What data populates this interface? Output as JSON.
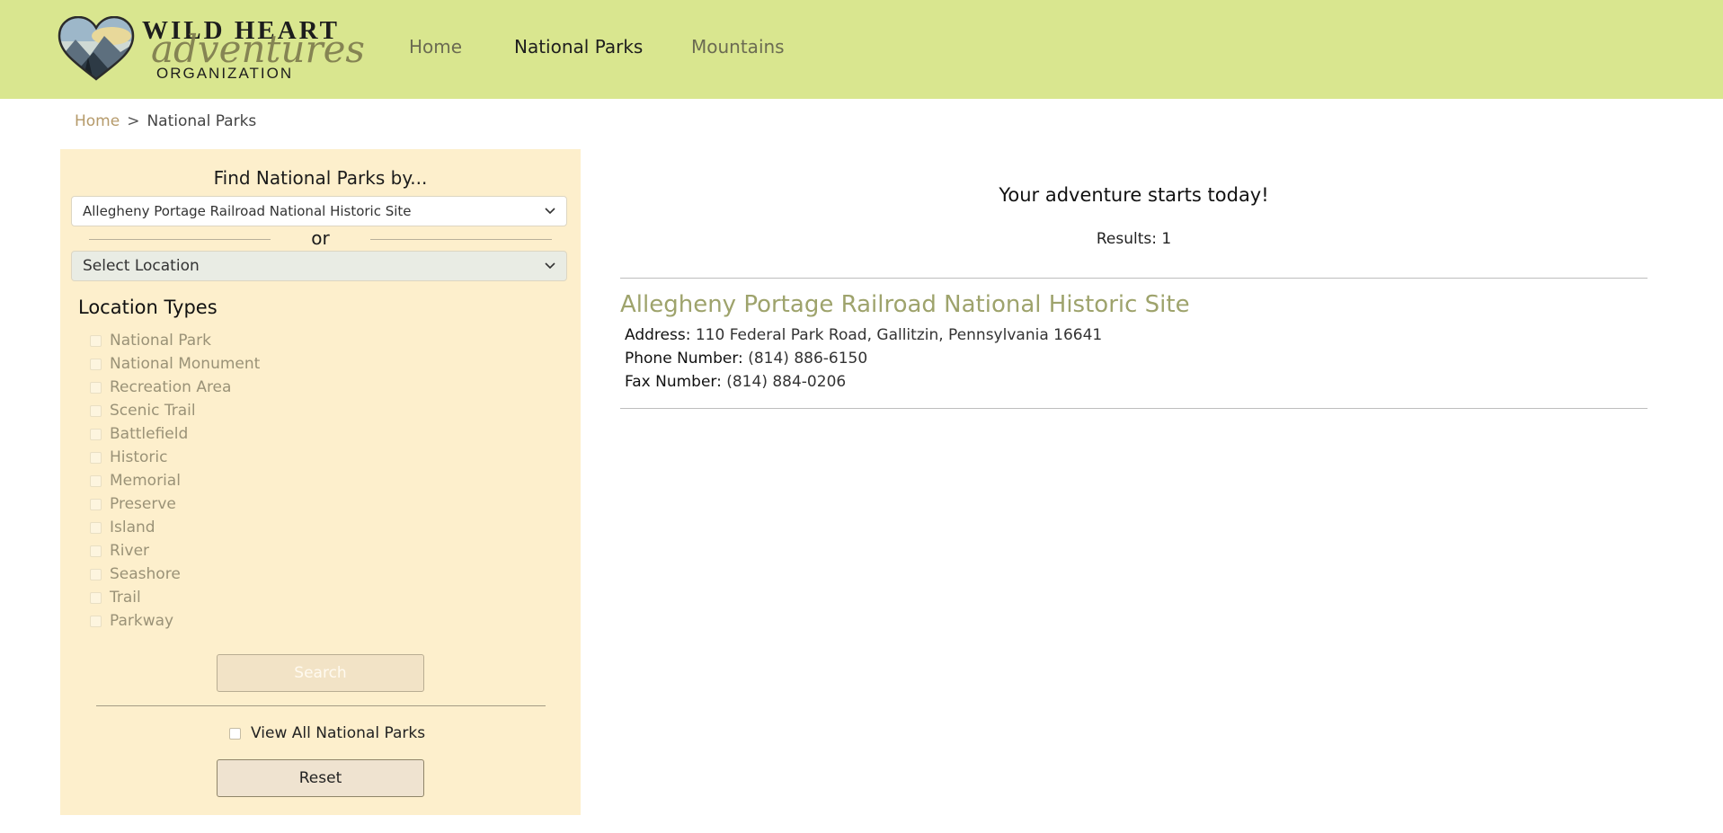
{
  "logo": {
    "line1": "WILD HEART",
    "line2": "adventures",
    "line3": "ORGANIZATION"
  },
  "nav": {
    "items": [
      {
        "label": "Home",
        "color": "#6b6b52"
      },
      {
        "label": "National Parks",
        "color": "#1e1e1e"
      },
      {
        "label": "Mountains",
        "color": "#6b6b52"
      }
    ]
  },
  "breadcrumb": {
    "home": "Home",
    "separator": ">",
    "current": "National Parks"
  },
  "sidebar": {
    "find_title": "Find National Parks by...",
    "park_select_value": "Allegheny Portage Railroad National Historic Site",
    "or_text": "or",
    "location_select_value": "Select Location",
    "location_types_title": "Location Types",
    "location_types": [
      "National Park",
      "National Monument",
      "Recreation Area",
      "Scenic Trail",
      "Battlefield",
      "Historic",
      "Memorial",
      "Preserve",
      "Island",
      "River",
      "Seashore",
      "Trail",
      "Parkway"
    ],
    "search_label": "Search",
    "view_all_label": "View All National Parks",
    "reset_label": "Reset"
  },
  "main": {
    "heading": "Your adventure starts today!",
    "results_label": "Results: 1",
    "result": {
      "name": "Allegheny Portage Railroad National Historic Site",
      "address_label": "Address:",
      "address": "110 Federal Park Road, Gallitzin, Pennsylvania 16641",
      "phone_label": "Phone Number:",
      "phone": "(814) 886-6150",
      "fax_label": "Fax Number:",
      "fax": "(814) 884-0206"
    }
  },
  "colors": {
    "header_bg": "#d9e68f",
    "sidebar_bg": "#fdefcc",
    "result_name": "#9ea36c",
    "breadcrumb_home": "#b59a6a"
  },
  "icons": [
    "heart-logo-icon",
    "chevron-down-icon"
  ]
}
